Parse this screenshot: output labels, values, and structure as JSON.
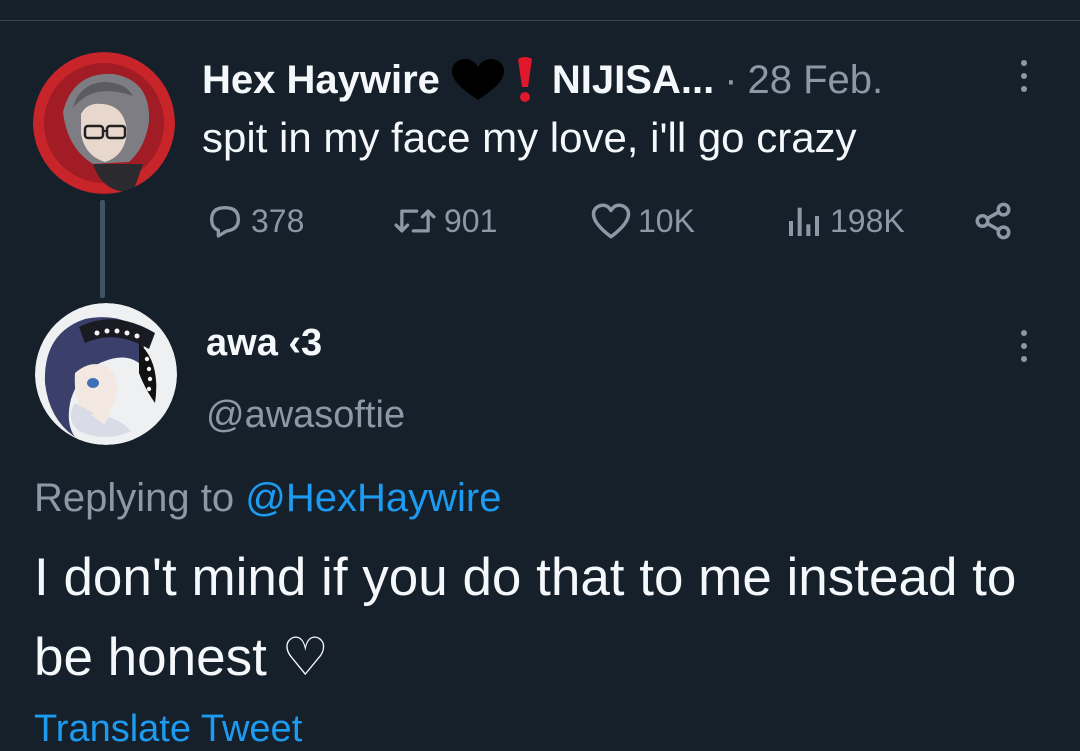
{
  "parent_tweet": {
    "display_name": "Hex Haywire",
    "display_name_suffix": "NIJISA...",
    "separator": "·",
    "date": "28 Feb.",
    "text": "spit in my face my love, i'll go crazy",
    "avatar_icon": "profile-photo",
    "emojis": [
      "black-heart-icon",
      "exclamation-icon"
    ],
    "stats": {
      "replies": "378",
      "retweets": "901",
      "likes": "10K",
      "views": "198K"
    }
  },
  "reply_tweet": {
    "display_name": "awa ‹3",
    "handle": "@awasoftie",
    "replying_prefix": "Replying to",
    "replying_to": "@HexHaywire",
    "text": "I don't mind if you do that to me instead to be honest ♡",
    "translate_label": "Translate Tweet"
  },
  "colors": {
    "background": "#15202b",
    "primary_text": "#f5f8fa",
    "secondary_text": "#8b98a5",
    "accent": "#1d9bf0"
  }
}
